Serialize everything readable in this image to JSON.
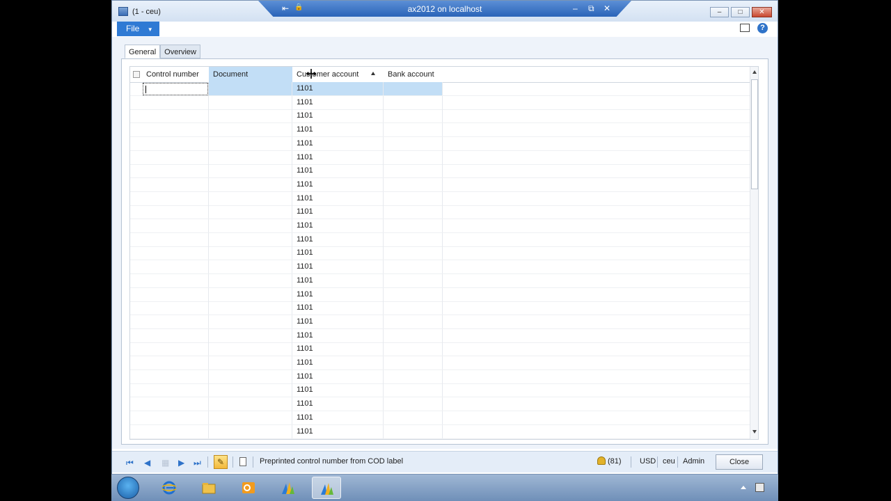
{
  "window": {
    "title": "(1 - ceu)",
    "remote_title": "ax2012 on localhost",
    "minimize": "–",
    "maximize": "□",
    "close": "✕",
    "rdp_pin": "⇤",
    "rdp_lock": "🔒",
    "rdp_min": "–",
    "rdp_restore": "⧉",
    "rdp_close": "✕"
  },
  "ribbon": {
    "file_label": "File",
    "help_label": "?"
  },
  "tabs": [
    {
      "label": "General"
    },
    {
      "label": "Overview"
    }
  ],
  "grid": {
    "columns": [
      {
        "label": "Control number"
      },
      {
        "label": "Document"
      },
      {
        "label": "Customer account"
      },
      {
        "label": "Bank account"
      }
    ],
    "rows": [
      {
        "control_number": "",
        "document": "",
        "customer_account": "1101",
        "bank_account": ""
      },
      {
        "control_number": "",
        "document": "",
        "customer_account": "1101",
        "bank_account": ""
      },
      {
        "control_number": "",
        "document": "",
        "customer_account": "1101",
        "bank_account": ""
      },
      {
        "control_number": "",
        "document": "",
        "customer_account": "1101",
        "bank_account": ""
      },
      {
        "control_number": "",
        "document": "",
        "customer_account": "1101",
        "bank_account": ""
      },
      {
        "control_number": "",
        "document": "",
        "customer_account": "1101",
        "bank_account": ""
      },
      {
        "control_number": "",
        "document": "",
        "customer_account": "1101",
        "bank_account": ""
      },
      {
        "control_number": "",
        "document": "",
        "customer_account": "1101",
        "bank_account": ""
      },
      {
        "control_number": "",
        "document": "",
        "customer_account": "1101",
        "bank_account": ""
      },
      {
        "control_number": "",
        "document": "",
        "customer_account": "1101",
        "bank_account": ""
      },
      {
        "control_number": "",
        "document": "",
        "customer_account": "1101",
        "bank_account": ""
      },
      {
        "control_number": "",
        "document": "",
        "customer_account": "1101",
        "bank_account": ""
      },
      {
        "control_number": "",
        "document": "",
        "customer_account": "1101",
        "bank_account": ""
      },
      {
        "control_number": "",
        "document": "",
        "customer_account": "1101",
        "bank_account": ""
      },
      {
        "control_number": "",
        "document": "",
        "customer_account": "1101",
        "bank_account": ""
      },
      {
        "control_number": "",
        "document": "",
        "customer_account": "1101",
        "bank_account": ""
      },
      {
        "control_number": "",
        "document": "",
        "customer_account": "1101",
        "bank_account": ""
      },
      {
        "control_number": "",
        "document": "",
        "customer_account": "1101",
        "bank_account": ""
      },
      {
        "control_number": "",
        "document": "",
        "customer_account": "1101",
        "bank_account": ""
      },
      {
        "control_number": "",
        "document": "",
        "customer_account": "1101",
        "bank_account": ""
      },
      {
        "control_number": "",
        "document": "",
        "customer_account": "1101",
        "bank_account": ""
      },
      {
        "control_number": "",
        "document": "",
        "customer_account": "1101",
        "bank_account": ""
      },
      {
        "control_number": "",
        "document": "",
        "customer_account": "1101",
        "bank_account": ""
      },
      {
        "control_number": "",
        "document": "",
        "customer_account": "1101",
        "bank_account": ""
      },
      {
        "control_number": "",
        "document": "",
        "customer_account": "1101",
        "bank_account": ""
      },
      {
        "control_number": "",
        "document": "",
        "customer_account": "1101",
        "bank_account": ""
      }
    ]
  },
  "statusbar": {
    "nav_first": "⏮",
    "nav_prev": "◀",
    "nav_next": "▶",
    "nav_last": "⏭",
    "message": "Preprinted control number from COD label",
    "notifications": "(81)",
    "currency": "USD",
    "company": "ceu",
    "user": "Admin",
    "close_label": "Close"
  },
  "colors": {
    "accent": "#2f7ad4",
    "selection": "#c2def6"
  },
  "icons": {
    "app": "app-icon",
    "bell": "notification-bell-icon",
    "help": "help-icon"
  }
}
